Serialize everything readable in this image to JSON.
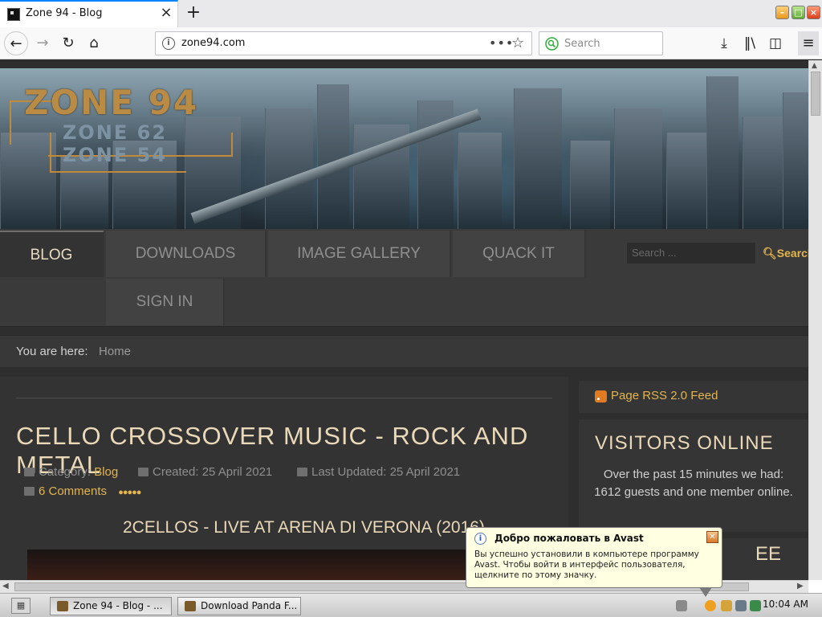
{
  "browser": {
    "tab_title": "Zone 94 - Blog",
    "tab_close": "×",
    "new_tab": "+",
    "url": "zone94.com",
    "url_actions": "•••",
    "search_placeholder": "Search",
    "icons": [
      "back-icon",
      "forward-icon",
      "reload-icon",
      "home-icon",
      "info-icon",
      "page-actions-icon",
      "bookmark-star-icon",
      "download-icon",
      "library-icon",
      "sidebar-icon",
      "hamburger-menu-icon"
    ]
  },
  "site": {
    "logo": {
      "main": "ZONE 94",
      "sub1": "ZONE 62",
      "sub2": "ZONE 54"
    },
    "menu": [
      {
        "label": "BLOG",
        "active": true
      },
      {
        "label": "DOWNLOADS",
        "active": false
      },
      {
        "label": "IMAGE GALLERY",
        "active": false
      },
      {
        "label": "QUACK IT",
        "active": false
      },
      {
        "label": "SIGN IN",
        "active": false
      }
    ],
    "search": {
      "placeholder": "Search ...",
      "button": "Search"
    },
    "breadcrumb": {
      "label": "You are here:",
      "home": "Home"
    },
    "article": {
      "title": "CELLO CROSSOVER MUSIC - ROCK AND METAL",
      "category_label": "Category:",
      "category": "Blog",
      "created": "Created: 25 April 2021",
      "updated": "Last Updated: 25 April 2021",
      "comments": "6 Comments",
      "subtitle": "2CELLOS - LIVE AT ARENA DI VERONA (2016)"
    },
    "sidebar": {
      "rss": "Page RSS 2.0 Feed",
      "visitors_title": "VISITORS ONLINE",
      "visitors_text": "Over the past 15 minutes we had: 1612 guests and one member online.",
      "partial_title": "EE"
    },
    "colors": {
      "accent": "#e3b54e",
      "heading": "#ead9b8",
      "background": "#2e2e2e"
    }
  },
  "taskbar": {
    "tasks": [
      "Zone 94 - Blog - ...",
      "Download Panda F..."
    ],
    "clock": "10:04 AM"
  },
  "avast": {
    "title": "Добро пожаловать в Avast",
    "message": "Вы успешно установили в компьютере программу Avast. Чтобы войти в интерфейс пользователя, щелкните по этому значку."
  }
}
